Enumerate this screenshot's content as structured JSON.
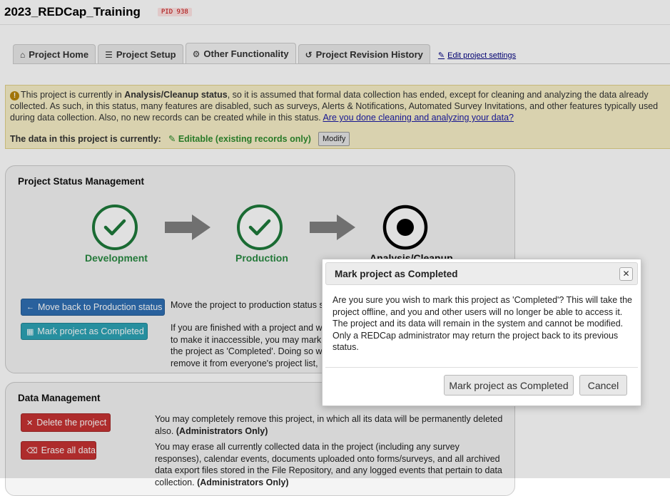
{
  "header": {
    "project_title": "2023_REDCap_Training",
    "pid_badge": "PID 938"
  },
  "tabs": [
    {
      "label": "Project Home",
      "icon": "home-icon"
    },
    {
      "label": "Project Setup",
      "icon": "list-check-icon"
    },
    {
      "label": "Other Functionality",
      "icon": "gear-icon"
    },
    {
      "label": "Project Revision History",
      "icon": "history-icon"
    }
  ],
  "edit_settings_link": "Edit project settings",
  "alert": {
    "text_1": "This project is currently in ",
    "status_bold": "Analysis/Cleanup status",
    "text_2": ", so it is assumed that formal data collection has ended, except for cleaning and analyzing the data already collected. As such, in this status, many features are disabled, such as surveys, Alerts & Notifications, Automated Survey Invitations, and other features typically used during data collection. Also, no new records can be created while in this status. ",
    "link": "Are you done cleaning and analyzing your data?",
    "status_label": "The data in this project is currently:",
    "status_value": "Editable (existing records only)",
    "modify_button": "Modify"
  },
  "status_management": {
    "title": "Project Status Management",
    "stages": [
      "Development",
      "Production",
      "Analysis/Cleanup"
    ],
    "move_back_button": "Move back to Production status",
    "move_back_desc": "Move the project to production status so that",
    "mark_completed_button": "Mark project as Completed",
    "completed_desc": "If you are finished with a project and wish to make it inaccessible, you may mark the project as 'Completed'. Doing so will remove it from everyone's project list, after which it can only be accessed via the Completed Projects link at the bottom of"
  },
  "data_management": {
    "title": "Data Management",
    "delete_button": "Delete the project",
    "delete_desc": "You may completely remove this project, in which all its data will be permanently deleted also.",
    "delete_admin": "(Administrators Only)",
    "erase_button": "Erase all data",
    "erase_desc": "You may erase all currently collected data in the project (including any survey responses), calendar events, documents uploaded onto forms/surveys, and all archived data export files stored in the File Repository, and any logged events that pertain to data collection.",
    "erase_admin": "(Administrators Only)"
  },
  "modal": {
    "title": "Mark project as Completed",
    "body": "Are you sure you wish to mark this project as 'Completed'? This will take the project offline, and you and other users will no longer be able to access it. The project and its data will remain in the system and cannot be modified. Only a REDCap administrator may return the project back to its previous status.",
    "confirm_button": "Mark project as Completed",
    "cancel_button": "Cancel"
  },
  "colors": {
    "stage_green": "#1e7a3b",
    "alert_bg": "#f7f0c8",
    "blue_button": "#2f6fb3",
    "teal_button": "#2da3b6",
    "red_button": "#c73333"
  }
}
